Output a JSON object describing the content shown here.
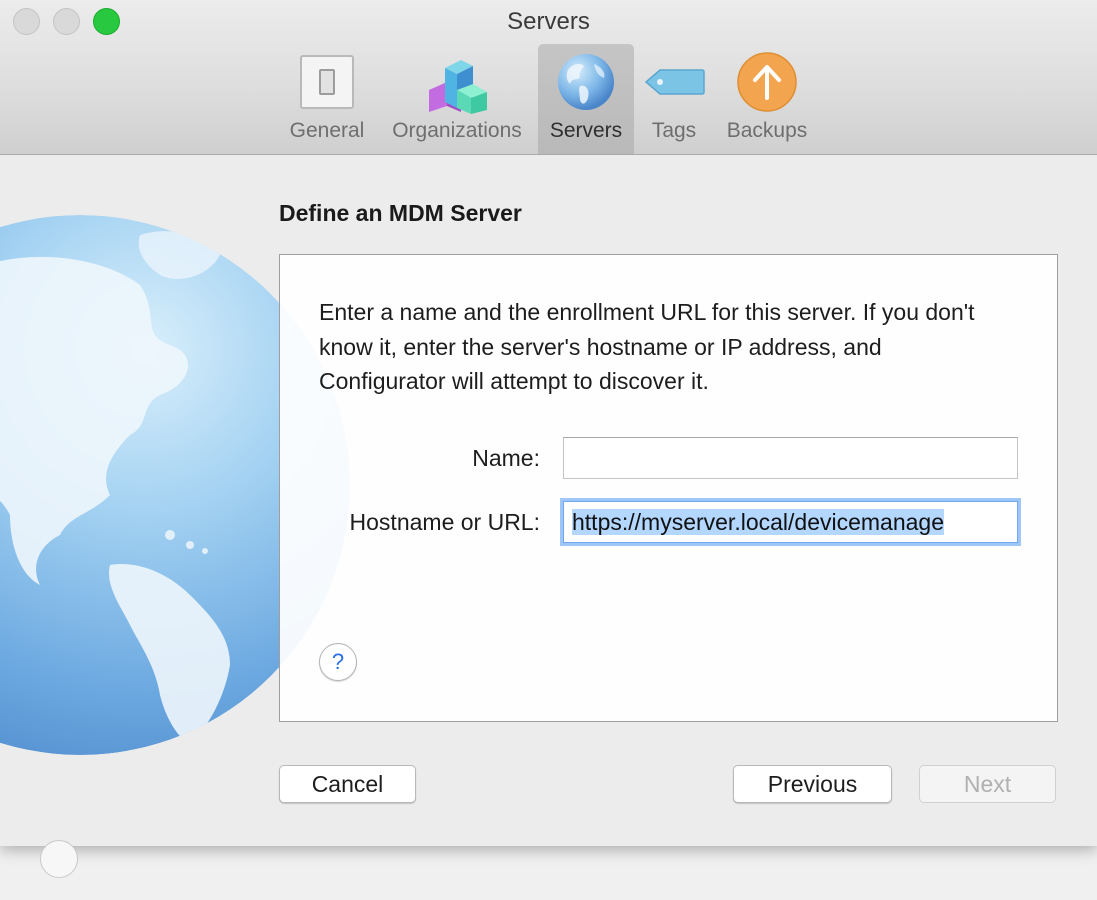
{
  "window": {
    "title": "Servers"
  },
  "toolbar": {
    "tabs": [
      {
        "label": "General",
        "icon": "switch-icon"
      },
      {
        "label": "Organizations",
        "icon": "blocks-icon"
      },
      {
        "label": "Servers",
        "icon": "globe-icon",
        "active": true
      },
      {
        "label": "Tags",
        "icon": "tag-icon"
      },
      {
        "label": "Backups",
        "icon": "upload-arrow-icon"
      }
    ]
  },
  "sheet": {
    "heading": "Define an MDM Server",
    "instructions": "Enter a name and the enrollment URL for this server. If you don't know it, enter the server's hostname or IP address, and Configurator will attempt to discover it.",
    "fields": {
      "name": {
        "label": "Name:",
        "value": ""
      },
      "hostname": {
        "label": "Hostname or URL:",
        "value": "https://myserver.local/devicemanage"
      }
    },
    "help": "?",
    "buttons": {
      "cancel": "Cancel",
      "previous": "Previous",
      "next": "Next"
    }
  },
  "colors": {
    "accent": "#2b6fe0",
    "focus_ring": "#9ec6f7",
    "selection": "#b3d7ff",
    "zoom_button": "#28c840",
    "backups_orange": "#f0a04b",
    "tags_blue": "#6fb9e0"
  }
}
